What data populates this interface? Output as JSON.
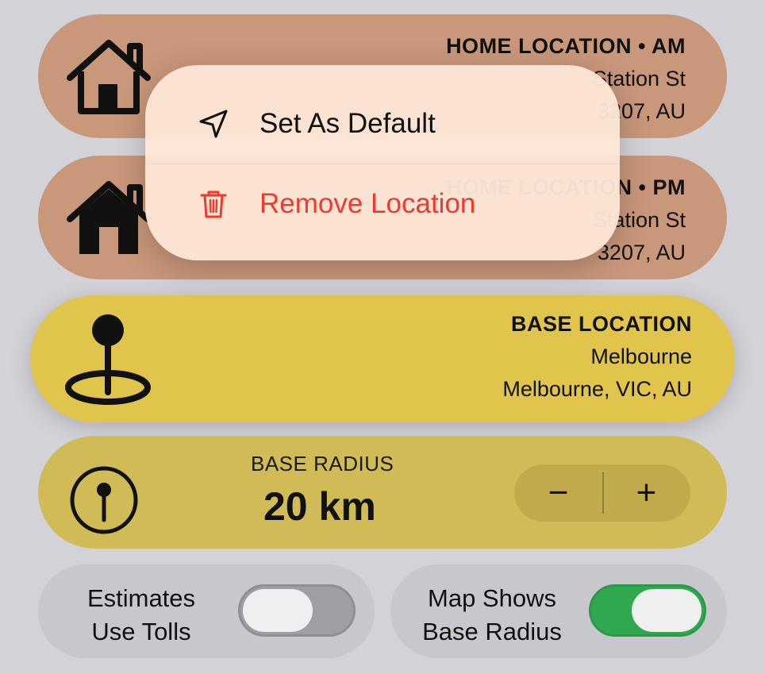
{
  "home_am": {
    "title": "HOME LOCATION • AM",
    "line1": "Station St",
    "line2": "3207, AU",
    "icon": "house-outline-icon"
  },
  "home_pm": {
    "title": "HOME LOCATION • PM",
    "line1": "Station St",
    "line2": "3207, AU",
    "icon": "house-filled-icon"
  },
  "base": {
    "title": "BASE LOCATION",
    "line1": "Melbourne",
    "line2": "Melbourne, VIC, AU",
    "icon": "map-pin-icon"
  },
  "radius": {
    "label": "BASE RADIUS",
    "value": "20 km",
    "minus": "−",
    "plus": "+",
    "icon": "compass-pin-icon"
  },
  "toggles": {
    "tolls": {
      "label_line1": "Estimates",
      "label_line2": "Use Tolls",
      "on": false
    },
    "map_radius": {
      "label_line1": "Map Shows",
      "label_line2": "Base Radius",
      "on": true
    }
  },
  "context_menu": {
    "items": [
      {
        "label": "Set As Default",
        "icon": "location-arrow-icon"
      },
      {
        "label": "Remove Location",
        "icon": "trash-icon",
        "color": "#ee3b2e"
      }
    ]
  },
  "colors": {
    "home_card": "#c9977a",
    "base_card": "#e1c44c",
    "radius_card": "#d1bb56",
    "toggle_on": "#2fa84f",
    "background": "#d2d2d8"
  }
}
